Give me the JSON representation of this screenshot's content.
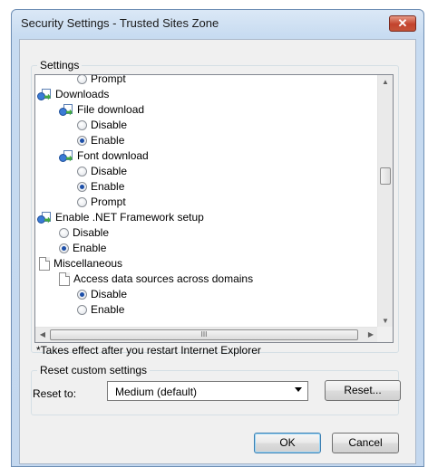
{
  "window": {
    "title": "Security Settings - Trusted Sites Zone",
    "close_symbol": "✕"
  },
  "settings_group": {
    "label": "Settings"
  },
  "tree": {
    "rows": [
      {
        "kind": "radio",
        "checked": false,
        "label": "Prompt"
      },
      {
        "kind": "category",
        "label": "Downloads"
      },
      {
        "kind": "setting",
        "label": "File download"
      },
      {
        "kind": "radio",
        "checked": false,
        "label": "Disable"
      },
      {
        "kind": "radio",
        "checked": true,
        "label": "Enable"
      },
      {
        "kind": "setting",
        "label": "Font download"
      },
      {
        "kind": "radio",
        "checked": false,
        "label": "Disable"
      },
      {
        "kind": "radio",
        "checked": true,
        "label": "Enable"
      },
      {
        "kind": "radio",
        "checked": false,
        "label": "Prompt"
      },
      {
        "kind": "setting",
        "label": "Enable .NET Framework setup"
      },
      {
        "kind": "radio",
        "checked": false,
        "label": "Disable"
      },
      {
        "kind": "radio",
        "checked": true,
        "label": "Enable"
      },
      {
        "kind": "doc",
        "label": "Miscellaneous"
      },
      {
        "kind": "doc",
        "label": "Access data sources across domains"
      },
      {
        "kind": "radio",
        "checked": true,
        "label": "Disable"
      },
      {
        "kind": "radio",
        "checked": false,
        "label": "Enable"
      }
    ],
    "hscroll_grip": "III"
  },
  "note": "*Takes effect after you restart Internet Explorer",
  "reset_group": {
    "label": "Reset custom settings",
    "reset_to_label": "Reset to:",
    "selected_level": "Medium (default)",
    "reset_button": "Reset..."
  },
  "buttons": {
    "ok": "OK",
    "cancel": "Cancel"
  }
}
